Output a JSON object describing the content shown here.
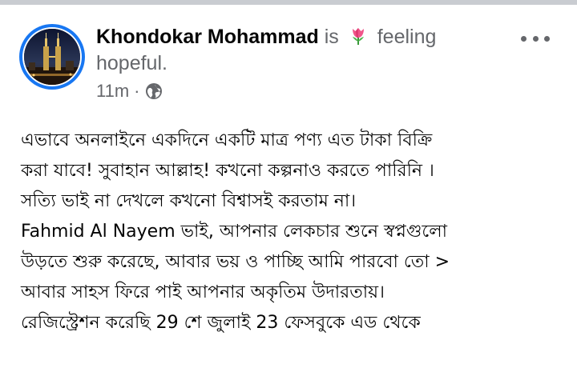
{
  "post": {
    "author": "Khondokar Mohammad",
    "activity_prefix": "is",
    "activity_emoji": "tulip-emoji",
    "activity_text": "feeling hopeful.",
    "timestamp": "11m",
    "separator": "·",
    "audience_icon": "globe-icon",
    "body_lines": [
      "এভাবে  অনলাইনে একদিনে একটি মাত্র পণ্য এত টাকা বিক্রি",
      "করা যাবে! সুবাহান আল্লাহ! কখনো কল্পনাও করতে পারিনি ।",
      "সত্যি ভাই না দেখলে কখনো বিশ্বাসই করতাম না।",
      "Fahmid Al Nayem ভাই, আপনার লেকচার শুনে স্বপ্নগুলো",
      "উড়তে শুরু করেছে, আবার ভয় ও পাচ্ছি আমি পারবো তো >",
      "আবার সাহস ফিরে  পাই আপনার অকৃতিম উদারতায়।",
      "রেজিস্ট্রেশন করেছি 29 শে জুলাই 23 ফেসবুকে এড থেকে"
    ]
  },
  "colors": {
    "accent": "#1877f2",
    "secondary_text": "#65676b",
    "primary_text": "#050505",
    "top_bar": "#c9ccd1"
  }
}
